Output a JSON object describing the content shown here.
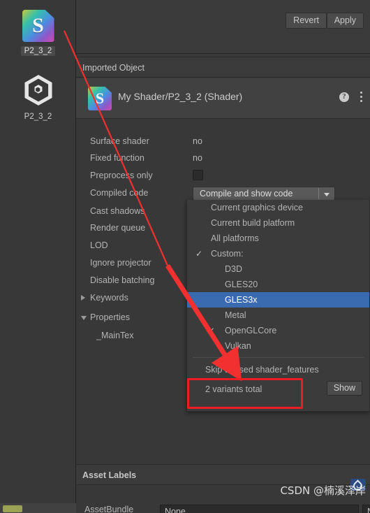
{
  "project_panel": {
    "items": [
      {
        "label": "P2_3_2",
        "icon": "shader-file-icon",
        "selected": true
      },
      {
        "label": "P2_3_2",
        "icon": "unity-prefab-icon",
        "selected": false
      }
    ]
  },
  "inspector": {
    "top_cut_text": ".",
    "revert_label": "Revert",
    "apply_label": "Apply",
    "imported_object_header": "Imported Object",
    "object_title": "My Shader/P2_3_2 (Shader)",
    "help_glyph": "?",
    "properties": [
      {
        "label": "Surface shader",
        "value": "no",
        "type": "text"
      },
      {
        "label": "Fixed function",
        "value": "no",
        "type": "text"
      },
      {
        "label": "Preprocess only",
        "value": "",
        "type": "checkbox",
        "checked": false
      },
      {
        "label": "Compiled code",
        "value": "Compile and show code",
        "type": "dropdown"
      },
      {
        "label": "Cast shadows",
        "value": "",
        "type": "text"
      },
      {
        "label": "Render queue",
        "value": "",
        "type": "text"
      },
      {
        "label": "LOD",
        "value": "",
        "type": "text"
      },
      {
        "label": "Ignore projector",
        "value": "",
        "type": "text"
      },
      {
        "label": "Disable batching",
        "value": "",
        "type": "text"
      },
      {
        "label": "Keywords",
        "value": "",
        "type": "foldout",
        "expanded": false
      },
      {
        "label": "Properties",
        "value": "",
        "type": "foldout",
        "expanded": true
      },
      {
        "label": "_MainTex",
        "value": "",
        "type": "text"
      }
    ],
    "dropdown": {
      "options": [
        {
          "label": "Current graphics device",
          "checked": false,
          "indent": false,
          "selected": false
        },
        {
          "label": "Current build platform",
          "checked": false,
          "indent": false,
          "selected": false
        },
        {
          "label": "All platforms",
          "checked": false,
          "indent": false,
          "selected": false
        },
        {
          "label": "Custom:",
          "checked": true,
          "indent": false,
          "selected": false
        },
        {
          "label": "D3D",
          "checked": false,
          "indent": true,
          "selected": false
        },
        {
          "label": "GLES20",
          "checked": false,
          "indent": true,
          "selected": false
        },
        {
          "label": "GLES3x",
          "checked": false,
          "indent": true,
          "selected": true
        },
        {
          "label": "Metal",
          "checked": false,
          "indent": true,
          "selected": false
        },
        {
          "label": "OpenGLCore",
          "checked": true,
          "indent": true,
          "selected": false
        },
        {
          "label": "Vulkan",
          "checked": false,
          "indent": true,
          "selected": false
        }
      ],
      "skip_label": "Skip unused shader_features",
      "variants_label": "2 variants total",
      "show_label": "Show",
      "check_glyph": "✓",
      "highlight_color": "#3a6ab0"
    },
    "asset_labels_header": "Asset Labels",
    "assetbundle": {
      "label": "AssetBundle",
      "name_value": "None",
      "variant_value": "None"
    }
  },
  "annotations": {
    "highlight_box_color": "#ee1c25",
    "arrow_color": "#f23030",
    "watermark": "CSDN @楠溪泽岸"
  }
}
